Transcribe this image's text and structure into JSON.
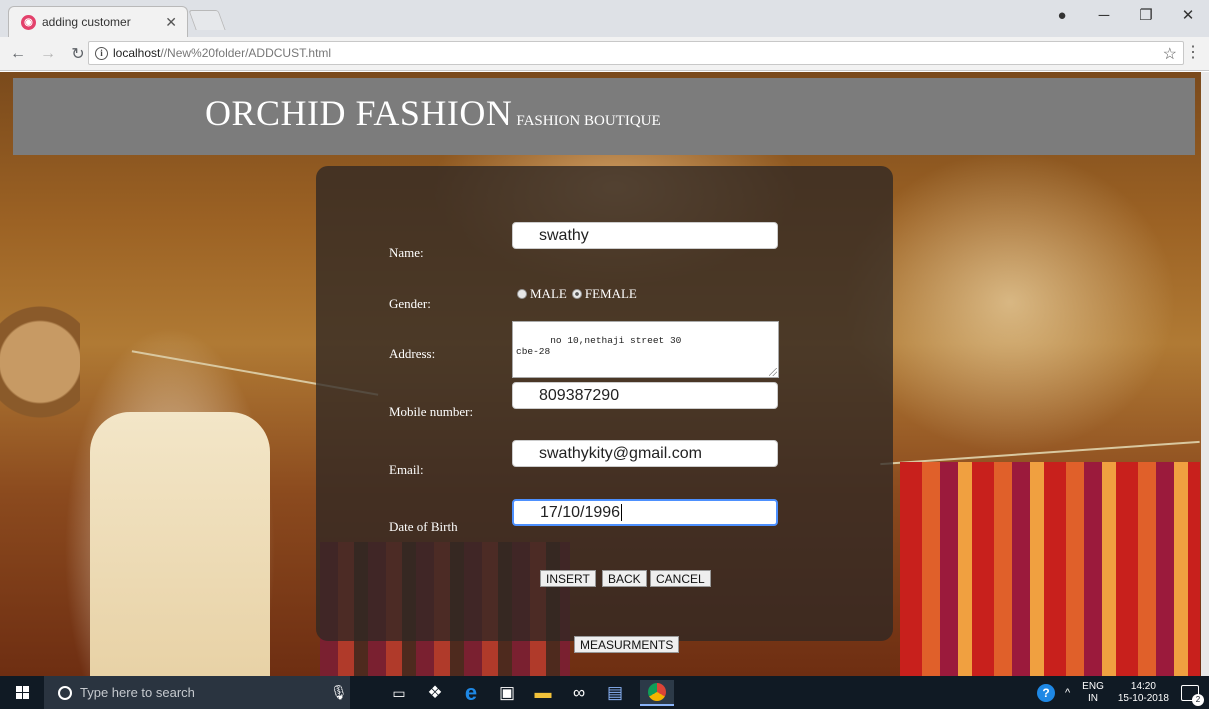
{
  "browser": {
    "tab_title": "adding customer",
    "url_host": "localhost",
    "url_path": "//New%20folder/ADDCUST.html"
  },
  "page": {
    "brand": "ORCHID FASHION",
    "tagline": "FASHION BOUTIQUE"
  },
  "form": {
    "name_label": "Name:",
    "name_value": "swathy",
    "gender_label": "Gender:",
    "gender_options": [
      "MALE",
      "FEMALE"
    ],
    "gender_selected": "FEMALE",
    "address_label": "Address:",
    "address_value": "no 10,nethaji street 30\ncbe-28",
    "mobile_label": "Mobile number:",
    "mobile_value": "809387290",
    "email_label": "Email:",
    "email_value": "swathykity@gmail.com",
    "dob_label": "Date of Birth",
    "dob_value": "17/10/1996"
  },
  "buttons": {
    "insert": "INSERT",
    "back": "BACK",
    "cancel": "CANCEL",
    "measurements": "MEASURMENTS"
  },
  "taskbar": {
    "search_placeholder": "Type here to search",
    "lang_line1": "ENG",
    "lang_line2": "IN",
    "time": "14:20",
    "date": "15-10-2018",
    "notification_count": "2"
  },
  "colors": {
    "header_band": "#7c7c7c",
    "form_panel": "#302824",
    "taskbar": "#101a24",
    "focus_ring": "#4d90fe"
  }
}
